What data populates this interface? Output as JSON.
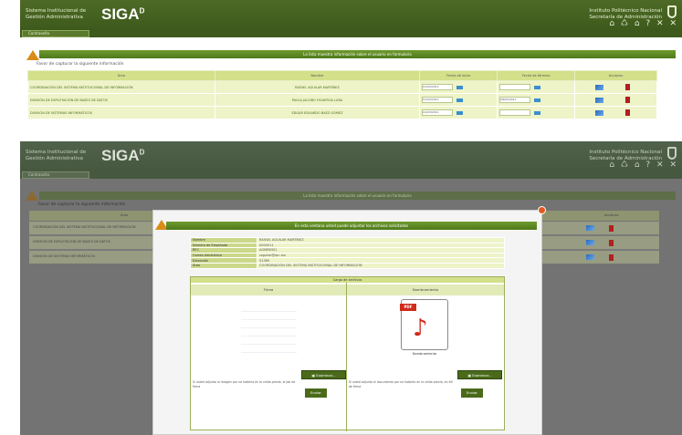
{
  "header": {
    "system_line1": "Sistema Institucional de",
    "system_line2": "Gestión Administrativa",
    "logo": "SIGA",
    "logo_sup": "D",
    "org_line1": "Instituto Politécnico Nacional",
    "org_line2": "Secretaría de Administración",
    "icons": "⌂ ♺ ⌂ ? ✕ ✕",
    "nav_tab": "Contraseña"
  },
  "panel": {
    "title": "La lista muestra información sobre el usuario en formulario",
    "section_label": "Favor de capturar la siguiente información",
    "columns": [
      "Área",
      "Nombre",
      "Fecha de inicio",
      "Fecha de término",
      "Acciones"
    ],
    "rows": [
      {
        "area": "COORDINACIÓN DEL SISTEMA INSTITUCIONAL DE INFORMACIÓN",
        "nombre": "RAFAEL AGUILAR MARTÍNEZ",
        "inicio": "01/03/2011",
        "termino": ""
      },
      {
        "area": "DIVISIÓN DE EXPLOTACIÓN DE BASES DE DATOS",
        "nombre": "PAULA JACOBO FIGUEROA LARA",
        "inicio": "01/03/2011",
        "termino": "28/03/2011"
      },
      {
        "area": "DIVISIÓN DE SISTEMAS INFORMÁTICOS",
        "nombre": "EDGAR EDUARDO BAEZ GÓMEZ",
        "inicio": "01/03/2011",
        "termino": ""
      }
    ],
    "section_label_dim": "Favor de capturar la siguiente información",
    "col_area_dim": "Área",
    "acciones_dim": "Acciones"
  },
  "modal": {
    "title": "En esta ventana usted puede adjuntar los archivos solicitados",
    "fields": [
      {
        "label": "Nombre",
        "value": "RAFAEL AGUILAR MARTÍNEZ"
      },
      {
        "label": "Número de Empleado",
        "value": "0000011"
      },
      {
        "label": "RFC",
        "value": "AGMR8301"
      },
      {
        "label": "Correo electrónico",
        "value": "raguilar@ipn.mx"
      },
      {
        "label": "Extensión",
        "value": "51385"
      },
      {
        "label": "Área",
        "value": "COORDINACIÓN DEL SISTEMA INSTITUCIONAL DE INFORMACIÓN"
      }
    ],
    "upload_header": "Carga de archivos",
    "firma_header": "Firma",
    "nombramiento_header": "Nombramiento",
    "pdf_tag": "PDF",
    "pdf_label": "Nombramiento",
    "examinar_label": "Examinar...",
    "firma_help": "Si usted adjunto la imagen por no haberla en la celda previa, el job de firma",
    "nomb_help": "Si usted adjunto el documento por no haberlo en la celda previa, en 60 de firma",
    "send_label": "Enviar"
  },
  "colors": {
    "header_green": "#3d5a1c",
    "accent_green": "#6e9a2e",
    "table_header": "#d4e08a",
    "row_bg": "#eef3c8",
    "warn_orange": "#d98c1a"
  }
}
